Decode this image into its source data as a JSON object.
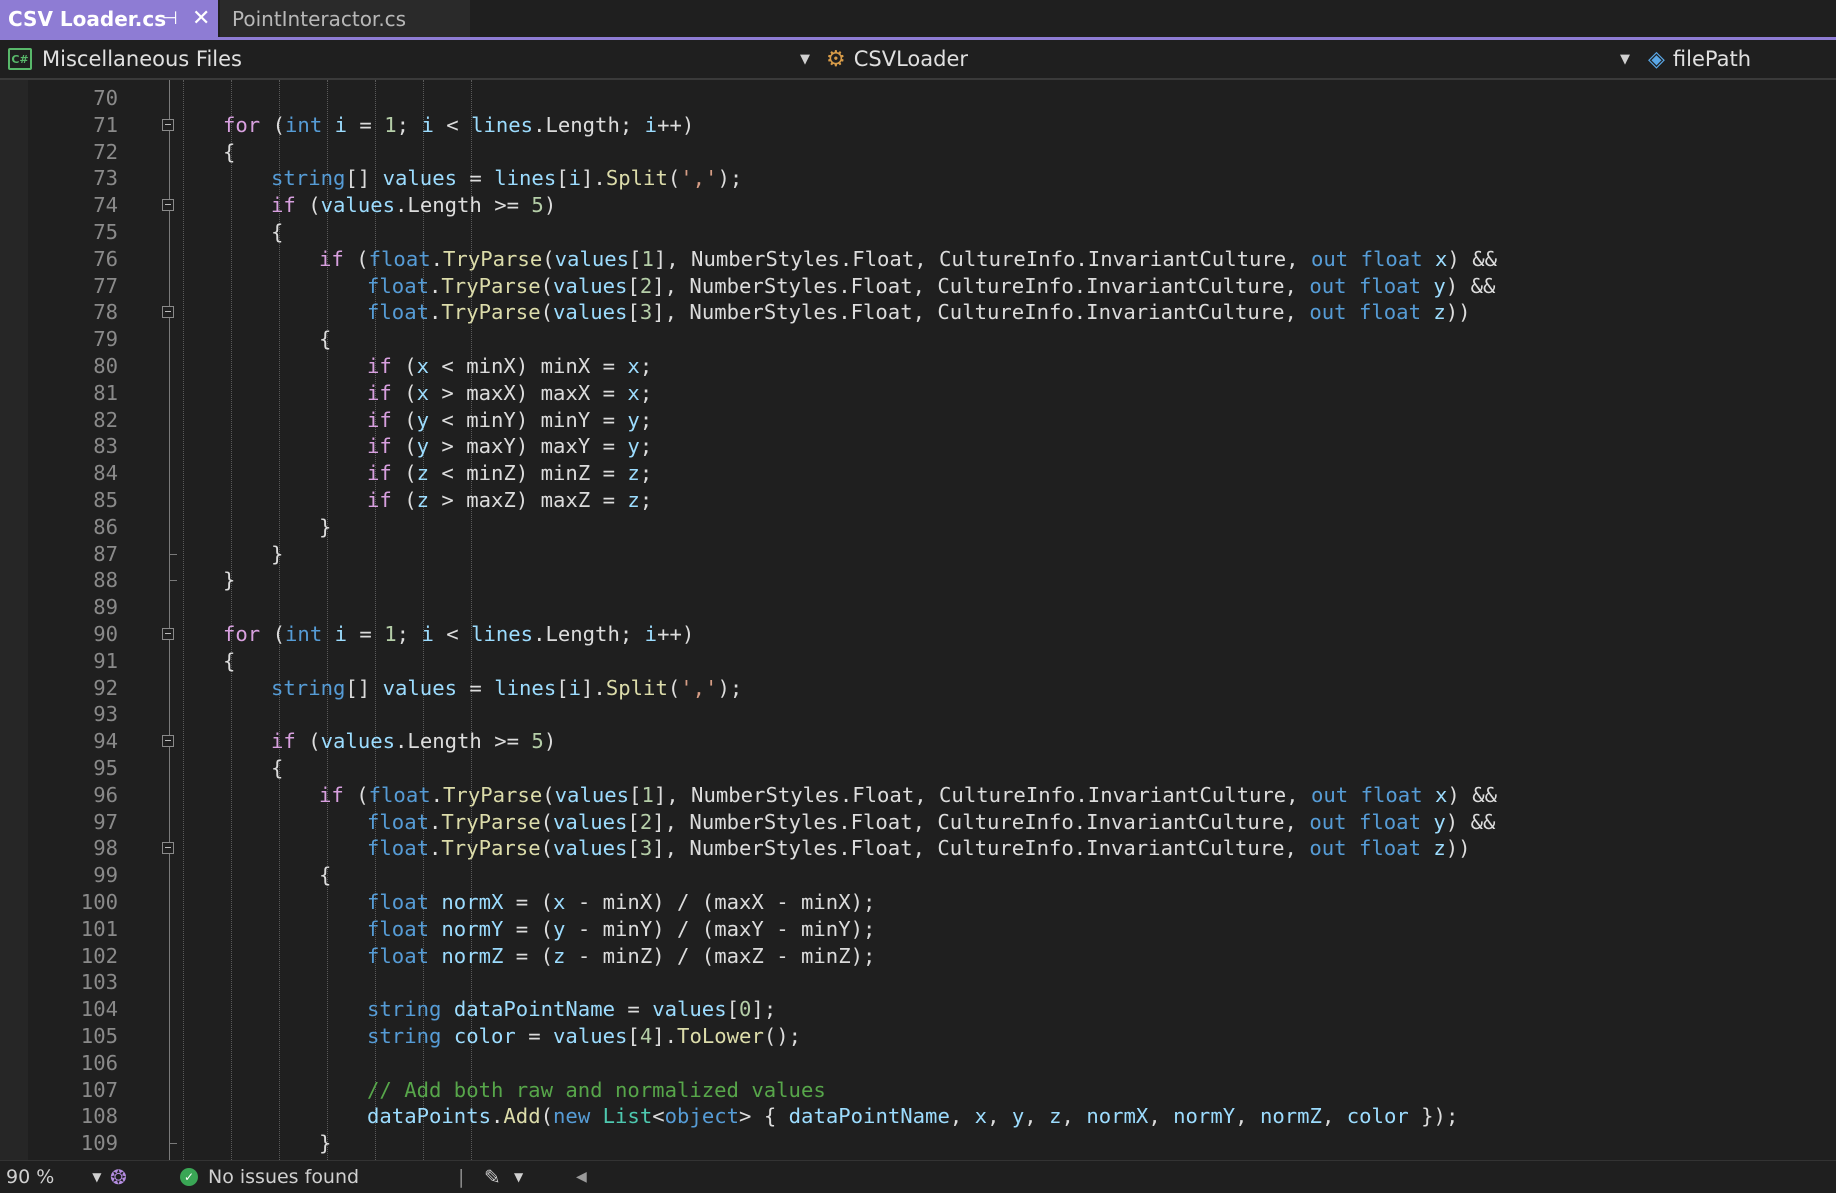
{
  "tabs": [
    {
      "label": "CSV Loader.cs",
      "active": true
    },
    {
      "label": "PointInteractor.cs",
      "active": false
    }
  ],
  "nav": {
    "project": "Miscellaneous Files",
    "type": "CSVLoader",
    "member": "filePath"
  },
  "status": {
    "zoom": "90 %",
    "issues": "No issues found"
  },
  "colors": {
    "accent": "#8e7cd4",
    "keyword": "#569cd6",
    "control": "#d8a0df",
    "method": "#dcdcaa",
    "variable": "#9cdcfe",
    "number": "#b5cea8",
    "string": "#d69d85",
    "comment": "#57a64a",
    "type": "#4ec9b0"
  },
  "lines": [
    {
      "n": "70",
      "indent": 0,
      "tokens": []
    },
    {
      "n": "71",
      "indent": 2,
      "fold": true,
      "tokens": [
        [
          "ctl",
          "for"
        ],
        [
          "pl",
          " ("
        ],
        [
          "kw",
          "int"
        ],
        [
          "pl",
          " "
        ],
        [
          "var",
          "i"
        ],
        [
          "pl",
          " = "
        ],
        [
          "num",
          "1"
        ],
        [
          "pl",
          "; "
        ],
        [
          "var",
          "i"
        ],
        [
          "pl",
          " < "
        ],
        [
          "var",
          "lines"
        ],
        [
          "pl",
          ".Length; "
        ],
        [
          "var",
          "i"
        ],
        [
          "pl",
          "++)"
        ]
      ]
    },
    {
      "n": "72",
      "indent": 2,
      "tokens": [
        [
          "pl",
          "{"
        ]
      ]
    },
    {
      "n": "73",
      "indent": 3,
      "tokens": [
        [
          "kw",
          "string"
        ],
        [
          "pl",
          "[] "
        ],
        [
          "var",
          "values"
        ],
        [
          "pl",
          " = "
        ],
        [
          "var",
          "lines"
        ],
        [
          "pl",
          "["
        ],
        [
          "var",
          "i"
        ],
        [
          "pl",
          "]."
        ],
        [
          "fn",
          "Split"
        ],
        [
          "pl",
          "("
        ],
        [
          "str",
          "','"
        ],
        [
          "pl",
          ");"
        ]
      ]
    },
    {
      "n": "74",
      "indent": 3,
      "fold": true,
      "tokens": [
        [
          "ctl",
          "if"
        ],
        [
          "pl",
          " ("
        ],
        [
          "var",
          "values"
        ],
        [
          "pl",
          ".Length >= "
        ],
        [
          "num",
          "5"
        ],
        [
          "pl",
          ")"
        ]
      ]
    },
    {
      "n": "75",
      "indent": 3,
      "tokens": [
        [
          "pl",
          "{"
        ]
      ]
    },
    {
      "n": "76",
      "indent": 4,
      "tokens": [
        [
          "ctl",
          "if"
        ],
        [
          "pl",
          " ("
        ],
        [
          "kw",
          "float"
        ],
        [
          "pl",
          "."
        ],
        [
          "fn",
          "TryParse"
        ],
        [
          "pl",
          "("
        ],
        [
          "var",
          "values"
        ],
        [
          "pl",
          "["
        ],
        [
          "num",
          "1"
        ],
        [
          "pl",
          "], NumberStyles.Float, CultureInfo.InvariantCulture, "
        ],
        [
          "kw",
          "out"
        ],
        [
          "pl",
          " "
        ],
        [
          "kw",
          "float"
        ],
        [
          "pl",
          " "
        ],
        [
          "var",
          "x"
        ],
        [
          "pl",
          ") &&"
        ]
      ]
    },
    {
      "n": "77",
      "indent": 5,
      "tokens": [
        [
          "kw",
          "float"
        ],
        [
          "pl",
          "."
        ],
        [
          "fn",
          "TryParse"
        ],
        [
          "pl",
          "("
        ],
        [
          "var",
          "values"
        ],
        [
          "pl",
          "["
        ],
        [
          "num",
          "2"
        ],
        [
          "pl",
          "], NumberStyles.Float, CultureInfo.InvariantCulture, "
        ],
        [
          "kw",
          "out"
        ],
        [
          "pl",
          " "
        ],
        [
          "kw",
          "float"
        ],
        [
          "pl",
          " "
        ],
        [
          "var",
          "y"
        ],
        [
          "pl",
          ") &&"
        ]
      ]
    },
    {
      "n": "78",
      "indent": 5,
      "fold": true,
      "tokens": [
        [
          "kw",
          "float"
        ],
        [
          "pl",
          "."
        ],
        [
          "fn",
          "TryParse"
        ],
        [
          "pl",
          "("
        ],
        [
          "var",
          "values"
        ],
        [
          "pl",
          "["
        ],
        [
          "num",
          "3"
        ],
        [
          "pl",
          "], NumberStyles.Float, CultureInfo.InvariantCulture, "
        ],
        [
          "kw",
          "out"
        ],
        [
          "pl",
          " "
        ],
        [
          "kw",
          "float"
        ],
        [
          "pl",
          " "
        ],
        [
          "var",
          "z"
        ],
        [
          "pl",
          "))"
        ]
      ]
    },
    {
      "n": "79",
      "indent": 4,
      "tokens": [
        [
          "pl",
          "{"
        ]
      ]
    },
    {
      "n": "80",
      "indent": 5,
      "tokens": [
        [
          "ctl",
          "if"
        ],
        [
          "pl",
          " ("
        ],
        [
          "var",
          "x"
        ],
        [
          "pl",
          " < minX) minX = "
        ],
        [
          "var",
          "x"
        ],
        [
          "pl",
          ";"
        ]
      ]
    },
    {
      "n": "81",
      "indent": 5,
      "tokens": [
        [
          "ctl",
          "if"
        ],
        [
          "pl",
          " ("
        ],
        [
          "var",
          "x"
        ],
        [
          "pl",
          " > maxX) maxX = "
        ],
        [
          "var",
          "x"
        ],
        [
          "pl",
          ";"
        ]
      ]
    },
    {
      "n": "82",
      "indent": 5,
      "tokens": [
        [
          "ctl",
          "if"
        ],
        [
          "pl",
          " ("
        ],
        [
          "var",
          "y"
        ],
        [
          "pl",
          " < minY) minY = "
        ],
        [
          "var",
          "y"
        ],
        [
          "pl",
          ";"
        ]
      ]
    },
    {
      "n": "83",
      "indent": 5,
      "tokens": [
        [
          "ctl",
          "if"
        ],
        [
          "pl",
          " ("
        ],
        [
          "var",
          "y"
        ],
        [
          "pl",
          " > maxY) maxY = "
        ],
        [
          "var",
          "y"
        ],
        [
          "pl",
          ";"
        ]
      ]
    },
    {
      "n": "84",
      "indent": 5,
      "tokens": [
        [
          "ctl",
          "if"
        ],
        [
          "pl",
          " ("
        ],
        [
          "var",
          "z"
        ],
        [
          "pl",
          " < minZ) minZ = "
        ],
        [
          "var",
          "z"
        ],
        [
          "pl",
          ";"
        ]
      ]
    },
    {
      "n": "85",
      "indent": 5,
      "tokens": [
        [
          "ctl",
          "if"
        ],
        [
          "pl",
          " ("
        ],
        [
          "var",
          "z"
        ],
        [
          "pl",
          " > maxZ) maxZ = "
        ],
        [
          "var",
          "z"
        ],
        [
          "pl",
          ";"
        ]
      ]
    },
    {
      "n": "86",
      "indent": 4,
      "tokens": [
        [
          "pl",
          "}"
        ]
      ]
    },
    {
      "n": "87",
      "indent": 3,
      "foldEnd": true,
      "tokens": [
        [
          "pl",
          "}"
        ]
      ]
    },
    {
      "n": "88",
      "indent": 2,
      "foldEnd": true,
      "tokens": [
        [
          "pl",
          "}"
        ]
      ]
    },
    {
      "n": "89",
      "indent": 0,
      "tokens": []
    },
    {
      "n": "90",
      "indent": 2,
      "fold": true,
      "tokens": [
        [
          "ctl",
          "for"
        ],
        [
          "pl",
          " ("
        ],
        [
          "kw",
          "int"
        ],
        [
          "pl",
          " "
        ],
        [
          "var",
          "i"
        ],
        [
          "pl",
          " = "
        ],
        [
          "num",
          "1"
        ],
        [
          "pl",
          "; "
        ],
        [
          "var",
          "i"
        ],
        [
          "pl",
          " < "
        ],
        [
          "var",
          "lines"
        ],
        [
          "pl",
          ".Length; "
        ],
        [
          "var",
          "i"
        ],
        [
          "pl",
          "++)"
        ]
      ]
    },
    {
      "n": "91",
      "indent": 2,
      "tokens": [
        [
          "pl",
          "{"
        ]
      ]
    },
    {
      "n": "92",
      "indent": 3,
      "tokens": [
        [
          "kw",
          "string"
        ],
        [
          "pl",
          "[] "
        ],
        [
          "var",
          "values"
        ],
        [
          "pl",
          " = "
        ],
        [
          "var",
          "lines"
        ],
        [
          "pl",
          "["
        ],
        [
          "var",
          "i"
        ],
        [
          "pl",
          "]."
        ],
        [
          "fn",
          "Split"
        ],
        [
          "pl",
          "("
        ],
        [
          "str",
          "','"
        ],
        [
          "pl",
          ");"
        ]
      ]
    },
    {
      "n": "93",
      "indent": 0,
      "tokens": []
    },
    {
      "n": "94",
      "indent": 3,
      "fold": true,
      "tokens": [
        [
          "ctl",
          "if"
        ],
        [
          "pl",
          " ("
        ],
        [
          "var",
          "values"
        ],
        [
          "pl",
          ".Length >= "
        ],
        [
          "num",
          "5"
        ],
        [
          "pl",
          ")"
        ]
      ]
    },
    {
      "n": "95",
      "indent": 3,
      "tokens": [
        [
          "pl",
          "{"
        ]
      ]
    },
    {
      "n": "96",
      "indent": 4,
      "tokens": [
        [
          "ctl",
          "if"
        ],
        [
          "pl",
          " ("
        ],
        [
          "kw",
          "float"
        ],
        [
          "pl",
          "."
        ],
        [
          "fn",
          "TryParse"
        ],
        [
          "pl",
          "("
        ],
        [
          "var",
          "values"
        ],
        [
          "pl",
          "["
        ],
        [
          "num",
          "1"
        ],
        [
          "pl",
          "], NumberStyles.Float, CultureInfo.InvariantCulture, "
        ],
        [
          "kw",
          "out"
        ],
        [
          "pl",
          " "
        ],
        [
          "kw",
          "float"
        ],
        [
          "pl",
          " "
        ],
        [
          "var",
          "x"
        ],
        [
          "pl",
          ") &&"
        ]
      ]
    },
    {
      "n": "97",
      "indent": 5,
      "tokens": [
        [
          "kw",
          "float"
        ],
        [
          "pl",
          "."
        ],
        [
          "fn",
          "TryParse"
        ],
        [
          "pl",
          "("
        ],
        [
          "var",
          "values"
        ],
        [
          "pl",
          "["
        ],
        [
          "num",
          "2"
        ],
        [
          "pl",
          "], NumberStyles.Float, CultureInfo.InvariantCulture, "
        ],
        [
          "kw",
          "out"
        ],
        [
          "pl",
          " "
        ],
        [
          "kw",
          "float"
        ],
        [
          "pl",
          " "
        ],
        [
          "var",
          "y"
        ],
        [
          "pl",
          ") &&"
        ]
      ]
    },
    {
      "n": "98",
      "indent": 5,
      "fold": true,
      "tokens": [
        [
          "kw",
          "float"
        ],
        [
          "pl",
          "."
        ],
        [
          "fn",
          "TryParse"
        ],
        [
          "pl",
          "("
        ],
        [
          "var",
          "values"
        ],
        [
          "pl",
          "["
        ],
        [
          "num",
          "3"
        ],
        [
          "pl",
          "], NumberStyles.Float, CultureInfo.InvariantCulture, "
        ],
        [
          "kw",
          "out"
        ],
        [
          "pl",
          " "
        ],
        [
          "kw",
          "float"
        ],
        [
          "pl",
          " "
        ],
        [
          "var",
          "z"
        ],
        [
          "pl",
          "))"
        ]
      ]
    },
    {
      "n": "99",
      "indent": 4,
      "tokens": [
        [
          "pl",
          "{"
        ]
      ]
    },
    {
      "n": "100",
      "indent": 5,
      "tokens": [
        [
          "kw",
          "float"
        ],
        [
          "pl",
          " "
        ],
        [
          "var",
          "normX"
        ],
        [
          "pl",
          " = ("
        ],
        [
          "var",
          "x"
        ],
        [
          "pl",
          " - minX) / (maxX - minX);"
        ]
      ]
    },
    {
      "n": "101",
      "indent": 5,
      "tokens": [
        [
          "kw",
          "float"
        ],
        [
          "pl",
          " "
        ],
        [
          "var",
          "normY"
        ],
        [
          "pl",
          " = ("
        ],
        [
          "var",
          "y"
        ],
        [
          "pl",
          " - minY) / (maxY - minY);"
        ]
      ]
    },
    {
      "n": "102",
      "indent": 5,
      "tokens": [
        [
          "kw",
          "float"
        ],
        [
          "pl",
          " "
        ],
        [
          "var",
          "normZ"
        ],
        [
          "pl",
          " = ("
        ],
        [
          "var",
          "z"
        ],
        [
          "pl",
          " - minZ) / (maxZ - minZ);"
        ]
      ]
    },
    {
      "n": "103",
      "indent": 0,
      "tokens": []
    },
    {
      "n": "104",
      "indent": 5,
      "tokens": [
        [
          "kw",
          "string"
        ],
        [
          "pl",
          " "
        ],
        [
          "var",
          "dataPointName"
        ],
        [
          "pl",
          " = "
        ],
        [
          "var",
          "values"
        ],
        [
          "pl",
          "["
        ],
        [
          "num",
          "0"
        ],
        [
          "pl",
          "];"
        ]
      ]
    },
    {
      "n": "105",
      "indent": 5,
      "tokens": [
        [
          "kw",
          "string"
        ],
        [
          "pl",
          " "
        ],
        [
          "var",
          "color"
        ],
        [
          "pl",
          " = "
        ],
        [
          "var",
          "values"
        ],
        [
          "pl",
          "["
        ],
        [
          "num",
          "4"
        ],
        [
          "pl",
          "]."
        ],
        [
          "fn",
          "ToLower"
        ],
        [
          "pl",
          "();"
        ]
      ]
    },
    {
      "n": "106",
      "indent": 0,
      "tokens": []
    },
    {
      "n": "107",
      "indent": 5,
      "tokens": [
        [
          "cmt",
          "// Add both raw and normalized values"
        ]
      ]
    },
    {
      "n": "108",
      "indent": 5,
      "tokens": [
        [
          "var",
          "dataPoints"
        ],
        [
          "pl",
          "."
        ],
        [
          "fn",
          "Add"
        ],
        [
          "pl",
          "("
        ],
        [
          "kw",
          "new"
        ],
        [
          "pl",
          " "
        ],
        [
          "typ",
          "List"
        ],
        [
          "pl",
          "<"
        ],
        [
          "kw",
          "object"
        ],
        [
          "pl",
          "> { "
        ],
        [
          "var",
          "dataPointName"
        ],
        [
          "pl",
          ", "
        ],
        [
          "var",
          "x"
        ],
        [
          "pl",
          ", "
        ],
        [
          "var",
          "y"
        ],
        [
          "pl",
          ", "
        ],
        [
          "var",
          "z"
        ],
        [
          "pl",
          ", "
        ],
        [
          "var",
          "normX"
        ],
        [
          "pl",
          ", "
        ],
        [
          "var",
          "normY"
        ],
        [
          "pl",
          ", "
        ],
        [
          "var",
          "normZ"
        ],
        [
          "pl",
          ", "
        ],
        [
          "var",
          "color"
        ],
        [
          "pl",
          " });"
        ]
      ]
    },
    {
      "n": "109",
      "indent": 4,
      "foldEnd": true,
      "tokens": [
        [
          "pl",
          "}"
        ]
      ]
    }
  ]
}
